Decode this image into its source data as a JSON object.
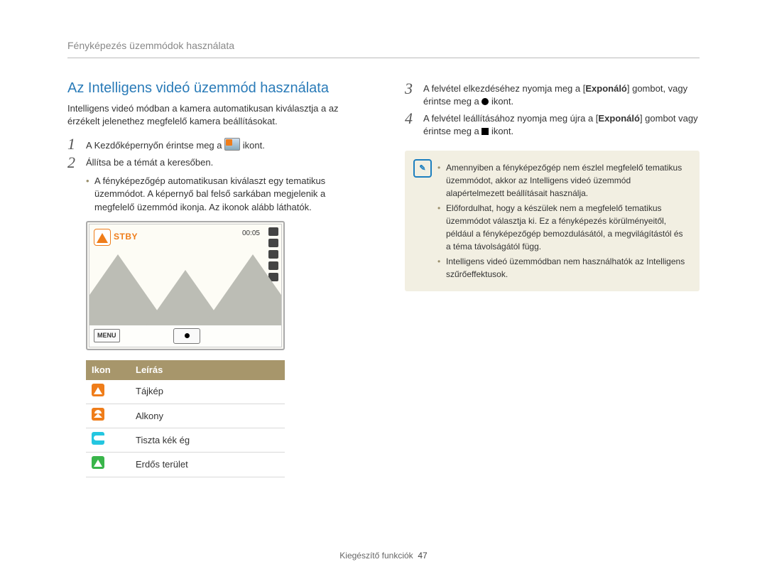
{
  "breadcrumb": "Fényképezés üzemmódok használata",
  "section_title": "Az Intelligens videó üzemmód használata",
  "intro": "Intelligens videó módban a kamera automatikusan kiválasztja a az érzékelt jelenethez megfelelő kamera beállításokat.",
  "step1": {
    "pre": "A Kezdőképernyőn érintse meg a ",
    "post": " ikont."
  },
  "step2": {
    "text": "Állítsa be a témát a keresőben.",
    "bullet": "A fényképezőgép automatikusan kiválaszt egy tematikus üzemmódot. A képernyő bal felső sarkában megjelenik a megfelelő üzemmód ikonja. Az ikonok alább láthatók."
  },
  "camera": {
    "stby": "STBY",
    "time": "00:05",
    "menu": "MENU"
  },
  "table": {
    "head_icon": "Ikon",
    "head_desc": "Leírás",
    "rows": [
      {
        "cls": "ic-orange",
        "desc": "Tájkép"
      },
      {
        "cls": "ic-dusk",
        "desc": "Alkony"
      },
      {
        "cls": "ic-sky",
        "desc": "Tiszta kék ég"
      },
      {
        "cls": "ic-forest",
        "desc": "Erdős terület"
      }
    ]
  },
  "step3": {
    "pre": "A felvétel elkezdéséhez nyomja meg a [",
    "bold": "Exponáló",
    "mid": "] gombot, vagy érintse meg a ",
    "post": " ikont."
  },
  "step4": {
    "pre": "A felvétel leállításához nyomja meg újra a [",
    "bold": "Exponáló",
    "mid": "] gombot vagy érintse meg a ",
    "post": " ikont."
  },
  "notes": [
    "Amennyiben a fényképezőgép nem észlel megfelelő tematikus üzemmódot, akkor az Intelligens videó üzemmód alapértelmezett beállításait használja.",
    "Előfordulhat, hogy a készülek nem a megfelelő tematikus üzemmódot választja ki. Ez a fényképezés körülményeitől, például a fényképezőgép bemozdulásától, a megvilágítástól és a téma távolságától függ.",
    "Intelligens videó üzemmódban nem használhatók az Intelligens szűrőeffektusok."
  ],
  "footer": {
    "section": "Kiegészítő funkciók",
    "page": "47"
  }
}
